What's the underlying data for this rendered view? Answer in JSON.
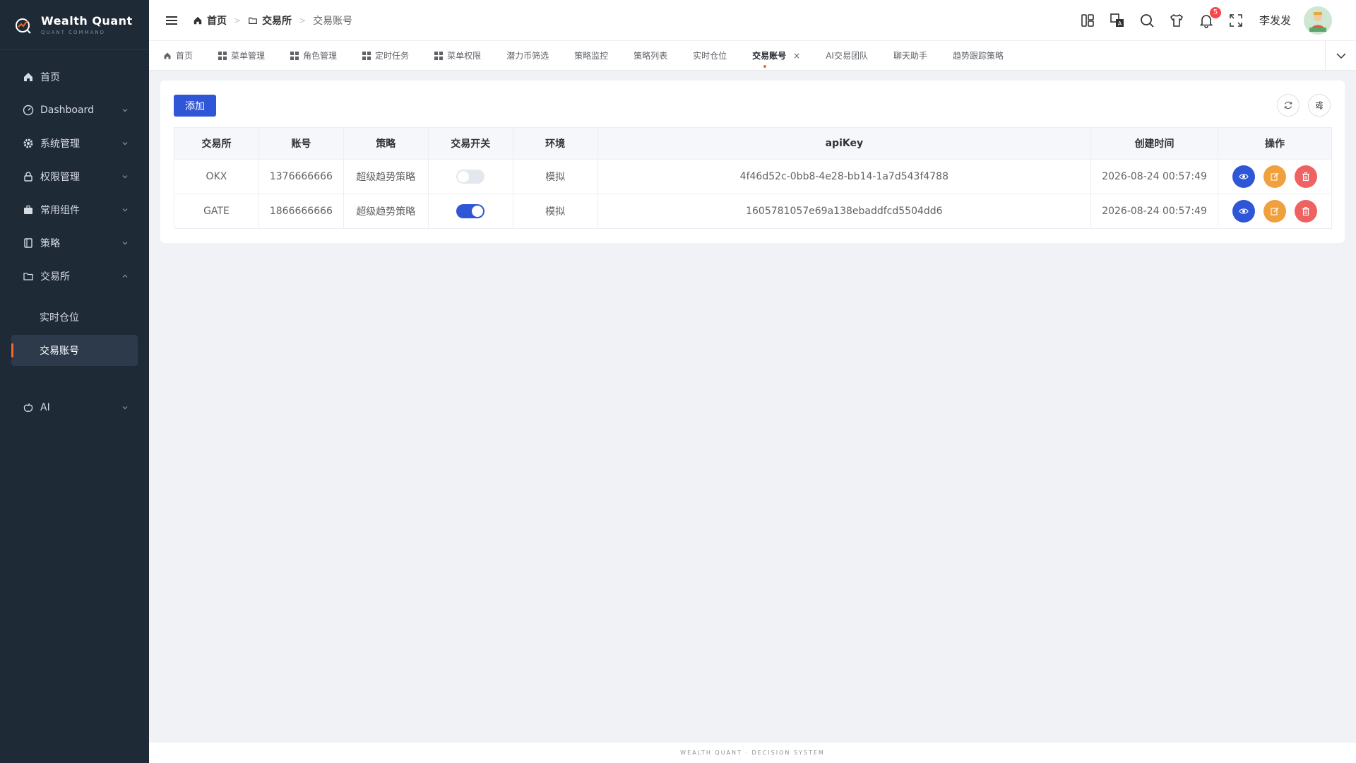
{
  "brand": {
    "title": "Wealth Quant",
    "subtitle": "QUANT COMMAND"
  },
  "sidebar": {
    "items": [
      {
        "label": "首页"
      },
      {
        "label": "Dashboard"
      },
      {
        "label": "系统管理"
      },
      {
        "label": "权限管理"
      },
      {
        "label": "常用组件"
      },
      {
        "label": "策略"
      },
      {
        "label": "交易所"
      }
    ],
    "sub_items": [
      {
        "label": "实时仓位"
      },
      {
        "label": "交易账号"
      }
    ],
    "ai": {
      "label": "AI"
    }
  },
  "breadcrumb": {
    "home": "首页",
    "exchange": "交易所",
    "current": "交易账号"
  },
  "header": {
    "notification_count": "5",
    "user_name": "李发发"
  },
  "tabs": [
    {
      "label": "首页"
    },
    {
      "label": "菜单管理"
    },
    {
      "label": "角色管理"
    },
    {
      "label": "定时任务"
    },
    {
      "label": "菜单权限"
    },
    {
      "label": "潜力币筛选"
    },
    {
      "label": "策略监控"
    },
    {
      "label": "策略列表"
    },
    {
      "label": "实时仓位"
    },
    {
      "label": "交易账号",
      "close": "×"
    },
    {
      "label": "AI交易团队"
    },
    {
      "label": "聊天助手"
    },
    {
      "label": "趋势跟踪策略"
    }
  ],
  "toolbar": {
    "add_label": "添加"
  },
  "table": {
    "headers": [
      "交易所",
      "账号",
      "策略",
      "交易开关",
      "环境",
      "apiKey",
      "创建时间",
      "操作"
    ],
    "rows": [
      {
        "exchange": "OKX",
        "account": "1376666666",
        "strategy": "超级趋势策略",
        "switch_on": false,
        "env": "模拟",
        "apikey": "4f46d52c-0bb8-4e28-bb14-1a7d543f4788",
        "created": "2026-08-24 00:57:49"
      },
      {
        "exchange": "GATE",
        "account": "1866666666",
        "strategy": "超级趋势策略",
        "switch_on": true,
        "env": "模拟",
        "apikey": "1605781057e69a138ebaddfcd5504dd6",
        "created": "2026-08-24 00:57:49"
      }
    ]
  },
  "footer": {
    "text": "WEALTH QUANT · DECISION SYSTEM"
  },
  "colors": {
    "primary": "#2f56d6",
    "warning": "#f0a03c",
    "danger": "#ef6262",
    "sidebar_bg": "#1f2a37",
    "accent": "#f06a2b"
  }
}
